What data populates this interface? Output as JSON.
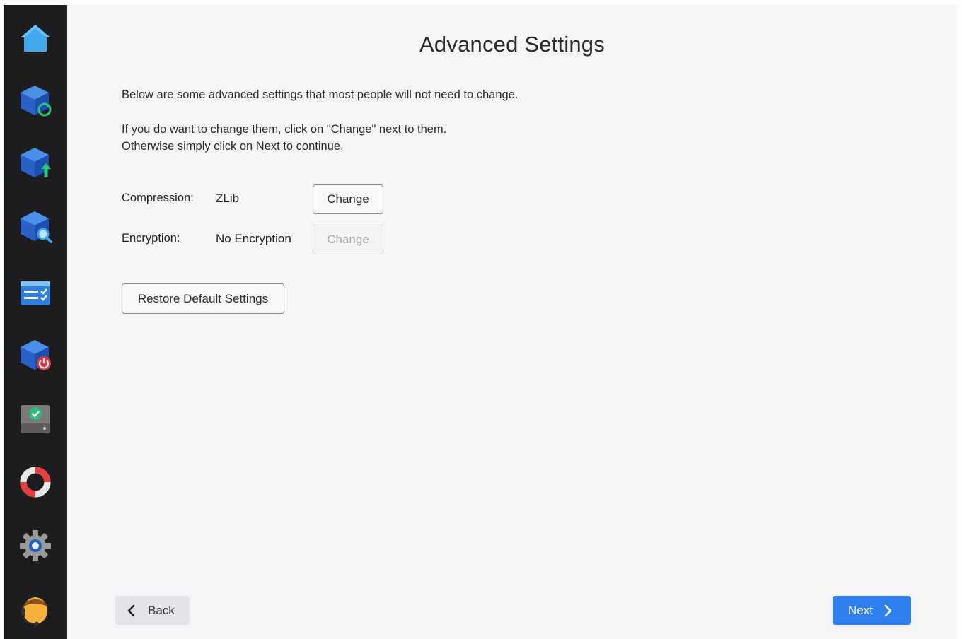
{
  "page": {
    "title": "Advanced Settings",
    "intro": "Below are some advanced settings that most people will not need to change.",
    "instructions_line1": "If you do want to change them, click on \"Change\" next to them.",
    "instructions_line2": "Otherwise simply click on Next to continue."
  },
  "settings": [
    {
      "label": "Compression:",
      "value": "ZLib",
      "button": "Change",
      "enabled": true
    },
    {
      "label": "Encryption:",
      "value": "No Encryption",
      "button": "Change",
      "enabled": false
    }
  ],
  "restore_label": "Restore Default Settings",
  "footer": {
    "back_label": "Back",
    "next_label": "Next"
  },
  "sidebar": {
    "items": [
      {
        "icon": "home-icon"
      },
      {
        "icon": "restore-backup-icon"
      },
      {
        "icon": "upload-backup-icon"
      },
      {
        "icon": "search-backup-icon"
      },
      {
        "icon": "task-list-icon"
      },
      {
        "icon": "shutdown-backup-icon"
      },
      {
        "icon": "drive-check-icon"
      },
      {
        "icon": "help-lifebuoy-icon"
      },
      {
        "icon": "gear-icon"
      },
      {
        "icon": "support-agent-icon"
      }
    ]
  },
  "colors": {
    "accent": "#2f7ff0",
    "sidebar": "#1d1d1f",
    "background": "#f5f5f7"
  }
}
